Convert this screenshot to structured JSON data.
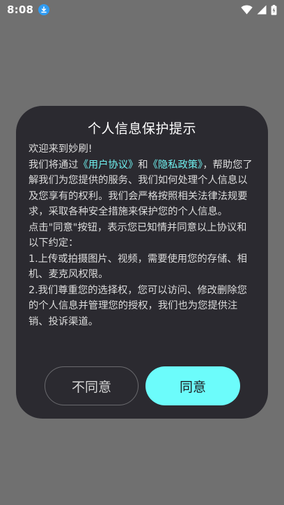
{
  "status_bar": {
    "time": "8:08",
    "icons": [
      "download-icon",
      "wifi-icon",
      "cellular-signal-icon",
      "battery-charging-icon"
    ]
  },
  "dialog": {
    "title": "个人信息保护提示",
    "welcome": "欢迎来到妙刷!",
    "para1_prefix": "我们将通过",
    "user_agreement_link": "《用户协议》",
    "and_text": "和",
    "privacy_policy_link": "《隐私政策》",
    "para1_suffix": "，帮助您了解我们为您提供的服务、我们如何处理个人信息以及您享有的权利。我们会严格按照相关法律法规要求，采取各种安全措施来保护您的个人信息。",
    "para2": "点击\"同意\"按钮，表示您已知情并同意以上协议和以下约定：",
    "item1": "1.上传或拍摄图片、视频，需要使用您的存储、相机、麦克风权限。",
    "item2": "2.我们尊重您的选择权，您可以访问、修改删除您的个人信息并管理您的授权，我们也为您提供注销、投诉渠道。",
    "disagree_label": "不同意",
    "agree_label": "同意"
  },
  "colors": {
    "overlay": "#707070",
    "dialog_bg": "#2b2a30",
    "link": "#6ff0ef",
    "agree_button": "#6cfcfb"
  }
}
